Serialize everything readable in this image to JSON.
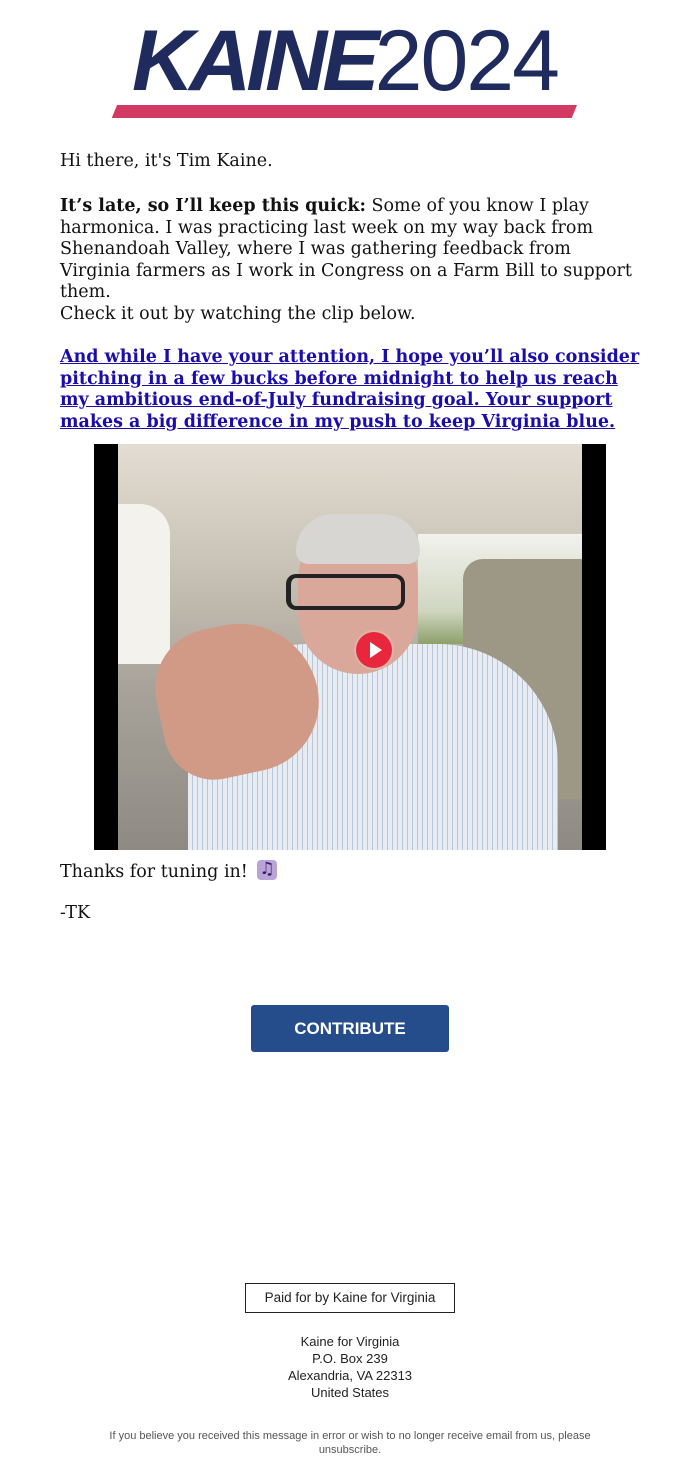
{
  "logo": {
    "bold": "KAINE",
    "light": "2024"
  },
  "email": {
    "greeting": "Hi there, it's Tim Kaine.",
    "intro_bold": "It’s late, so I’ll keep this quick:",
    "intro_rest": " Some of you know I play harmonica. I was practicing last week on my way back from Shenandoah Valley, where I was gathering feedback from Virginia farmers as I work in Congress on a Farm Bill to support them.",
    "check": "Check it out by watching the clip below.",
    "link": "And while I have your attention, I hope you’ll also consider pitching in a few bucks before midnight to help us reach my ambitious end-of-July fundraising goal. Your support makes a big difference in my push to keep Virginia blue.",
    "thanks": "Thanks for tuning in!",
    "thanks_icon": "musical-notes-icon",
    "signoff": "-TK"
  },
  "video": {
    "play_icon": "play-icon"
  },
  "cta": {
    "label": "CONTRIBUTE",
    "color": "#254d8b"
  },
  "footer": {
    "paid_for": "Paid for by Kaine for Virginia",
    "address": [
      "Kaine for Virginia",
      "P.O. Box 239",
      "Alexandria, VA 22313",
      "United States"
    ],
    "disclaimer": "If you believe you received this message in error or wish to no longer receive email from us, please unsubscribe."
  },
  "colors": {
    "navy": "#1f2b5c",
    "accent": "#d23a64",
    "link": "#1a0dab"
  }
}
